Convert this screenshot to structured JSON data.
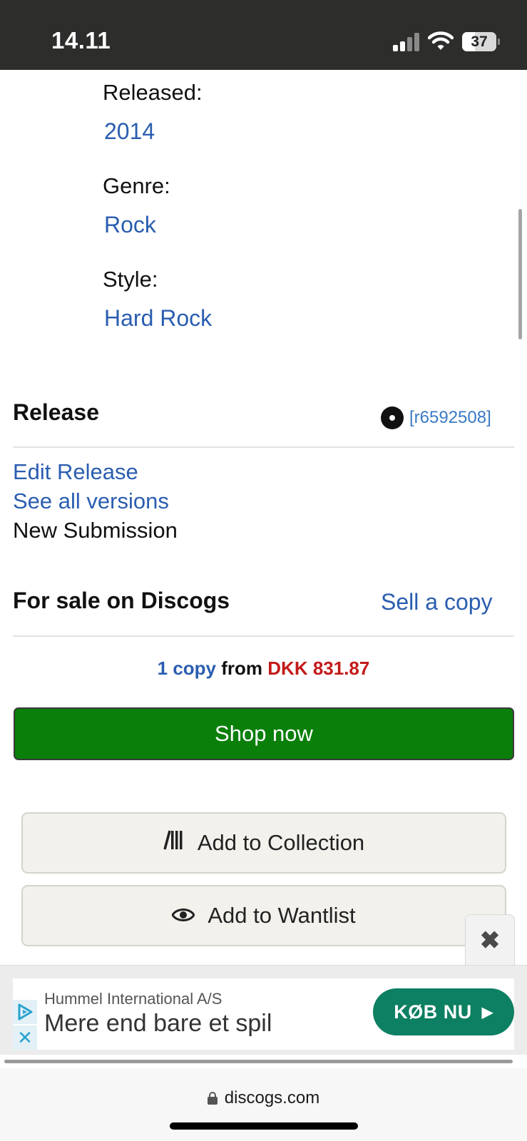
{
  "status_bar": {
    "time": "14.11",
    "battery_level": "37",
    "icons": [
      "cellular-signal-icon",
      "wifi-icon",
      "battery-icon"
    ]
  },
  "release_info": {
    "released_label": "Released:",
    "released_value": "2014",
    "genre_label": "Genre:",
    "genre_value": "Rock",
    "style_label": "Style:",
    "style_value": "Hard Rock"
  },
  "release_section": {
    "title": "Release",
    "release_id": "[r6592508]",
    "edit_release": "Edit Release",
    "see_all_versions": "See all versions",
    "new_submission": "New Submission"
  },
  "for_sale": {
    "title": "For sale on Discogs",
    "sell_link": "Sell a copy",
    "copy_count": "1 copy",
    "from_text": "from",
    "price": "DKK 831.87",
    "shop_button": "Shop now"
  },
  "actions": {
    "add_collection": "Add to Collection",
    "add_wantlist": "Add to Wantlist"
  },
  "ad": {
    "advertiser": "Hummel International A/S",
    "headline": "Mere end bare et spil",
    "cta": "KØB NU",
    "close_symbol": "✖",
    "adchoices_x": "✕",
    "cta_color": "#0d7f62"
  },
  "browser": {
    "url": "discogs.com"
  },
  "colors": {
    "link": "#2a5db0",
    "price": "#c41a1a",
    "shop_button": "#0a7f0a"
  }
}
